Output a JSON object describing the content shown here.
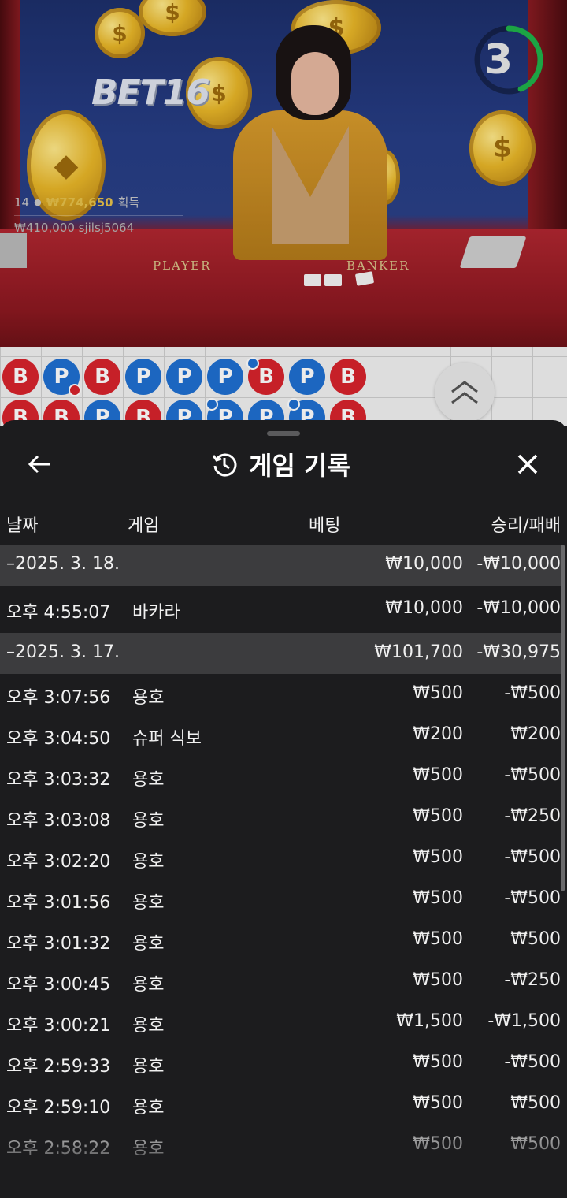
{
  "video": {
    "brand": "BET16",
    "timer": "3",
    "player_label": "PLAYER",
    "banker_label": "BANKER",
    "stats": {
      "count": "14",
      "win_amount": "₩774,650",
      "win_label": "획득",
      "bet_amount": "₩410,000",
      "username": "sjilsj5064"
    }
  },
  "bead_road": {
    "row1": [
      "B",
      "P",
      "B",
      "P",
      "P",
      "P",
      "B",
      "P",
      "B"
    ],
    "row2": [
      "B",
      "B",
      "P",
      "B",
      "P",
      "P",
      "P",
      "P",
      "B"
    ]
  },
  "sheet": {
    "title": "게임 기록",
    "columns": {
      "date": "날짜",
      "game": "게임",
      "bet": "베팅",
      "result": "승리/패배"
    },
    "rows": [
      {
        "type": "date",
        "time": "–2025. 3. 18.",
        "game": "",
        "bet": "₩10,000",
        "result": "-₩10,000"
      },
      {
        "type": "entry",
        "time": "오후 4:55:07",
        "game": "바카라",
        "bet": "₩10,000",
        "result": "-₩10,000"
      },
      {
        "type": "date",
        "time": "–2025. 3. 17.",
        "game": "",
        "bet": "₩101,700",
        "result": "-₩30,975"
      },
      {
        "type": "entry",
        "time": "오후 3:07:56",
        "game": "용호",
        "bet": "₩500",
        "result": "-₩500"
      },
      {
        "type": "entry",
        "time": "오후 3:04:50",
        "game": "슈퍼 식보",
        "bet": "₩200",
        "result": "₩200"
      },
      {
        "type": "entry",
        "time": "오후 3:03:32",
        "game": "용호",
        "bet": "₩500",
        "result": "-₩500"
      },
      {
        "type": "entry",
        "time": "오후 3:03:08",
        "game": "용호",
        "bet": "₩500",
        "result": "-₩250"
      },
      {
        "type": "entry",
        "time": "오후 3:02:20",
        "game": "용호",
        "bet": "₩500",
        "result": "-₩500"
      },
      {
        "type": "entry",
        "time": "오후 3:01:56",
        "game": "용호",
        "bet": "₩500",
        "result": "-₩500"
      },
      {
        "type": "entry",
        "time": "오후 3:01:32",
        "game": "용호",
        "bet": "₩500",
        "result": "₩500"
      },
      {
        "type": "entry",
        "time": "오후 3:00:45",
        "game": "용호",
        "bet": "₩500",
        "result": "-₩250"
      },
      {
        "type": "entry",
        "time": "오후 3:00:21",
        "game": "용호",
        "bet": "₩1,500",
        "result": "-₩1,500"
      },
      {
        "type": "entry",
        "time": "오후 2:59:33",
        "game": "용호",
        "bet": "₩500",
        "result": "-₩500"
      },
      {
        "type": "entry",
        "time": "오후 2:59:10",
        "game": "용호",
        "bet": "₩500",
        "result": "₩500"
      },
      {
        "type": "entry",
        "time": "오후 2:58:22",
        "game": "용호",
        "bet": "₩500",
        "result": "₩500"
      }
    ]
  },
  "colors": {
    "banker": "#d7232c",
    "player": "#1f6fd1",
    "timer_ring": "#1fb24a",
    "sheet_bg": "#1c1c1e",
    "date_row_bg": "#3c3c3e"
  }
}
